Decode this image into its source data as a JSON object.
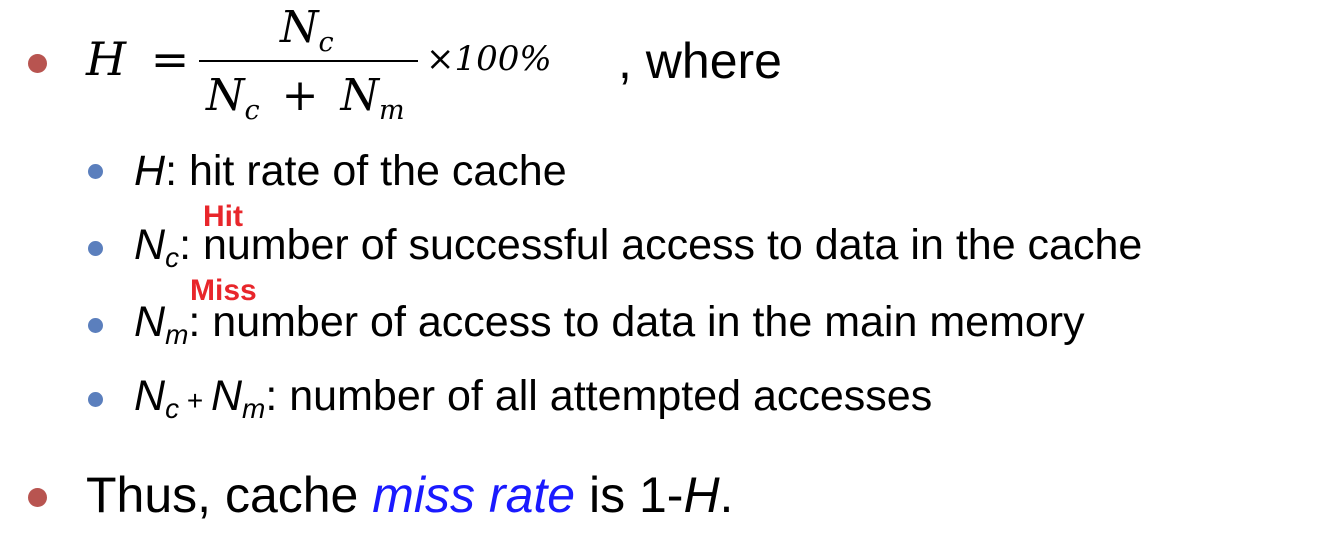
{
  "colors": {
    "bullet_level1": "#b85450",
    "bullet_level2": "#5b7fbd",
    "annotation": "#e8262b",
    "emphasis": "#1a1aff"
  },
  "formula": {
    "lhs": "H",
    "equals": "=",
    "numerator_sym": "N",
    "numerator_sub": "c",
    "denominator_sym1": "N",
    "denominator_sub1": "c",
    "denominator_plus": "+",
    "denominator_sym2": "N",
    "denominator_sub2": "m",
    "times": "×100%",
    "suffix": ", where"
  },
  "definitions": [
    {
      "sym": "H",
      "sub": "",
      "text": ":  hit rate of the cache"
    },
    {
      "sym": "N",
      "sub": "c",
      "text": ":  number of successful access to data in the cache",
      "annotation": "Hit"
    },
    {
      "sym": "N",
      "sub": "m",
      "text": ":  number of access to data in the main memory",
      "annotation": "Miss"
    },
    {
      "sym1": "N",
      "sub1": "c",
      "plus": " + ",
      "sym2": "N",
      "sub2": "m",
      "text": ": number of all attempted accesses"
    }
  ],
  "conclusion": {
    "prefix": "Thus, cache ",
    "emphasis": "miss rate",
    "middle": " is 1-",
    "sym": "H",
    "end": "."
  }
}
